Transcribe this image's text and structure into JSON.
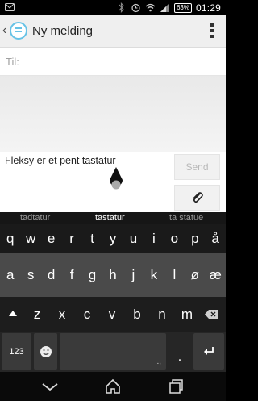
{
  "status_bar": {
    "battery": "63%",
    "time": "01:29"
  },
  "action_bar": {
    "title": "Ny melding"
  },
  "compose": {
    "to_placeholder": "Til:",
    "message_prefix": "Fleksy er et pent ",
    "message_underlined": "tastatur",
    "send_label": "Send"
  },
  "keyboard": {
    "suggestions": [
      "tadtatur",
      "tastatur",
      "ta statue"
    ],
    "row1": [
      "q",
      "w",
      "e",
      "r",
      "t",
      "y",
      "u",
      "i",
      "o",
      "p",
      "å"
    ],
    "row2": [
      "a",
      "s",
      "d",
      "f",
      "g",
      "h",
      "j",
      "k",
      "l",
      "ø",
      "æ"
    ],
    "row3": [
      "z",
      "x",
      "c",
      "v",
      "b",
      "n",
      "m"
    ],
    "numbers_label": "123",
    "period_label": ".",
    "space_hint": ".,"
  },
  "colors": {
    "app_accent": "#66c2e6",
    "keyboard_bg": "#1a1a1a",
    "row2_bg": "#4a4a4a"
  }
}
